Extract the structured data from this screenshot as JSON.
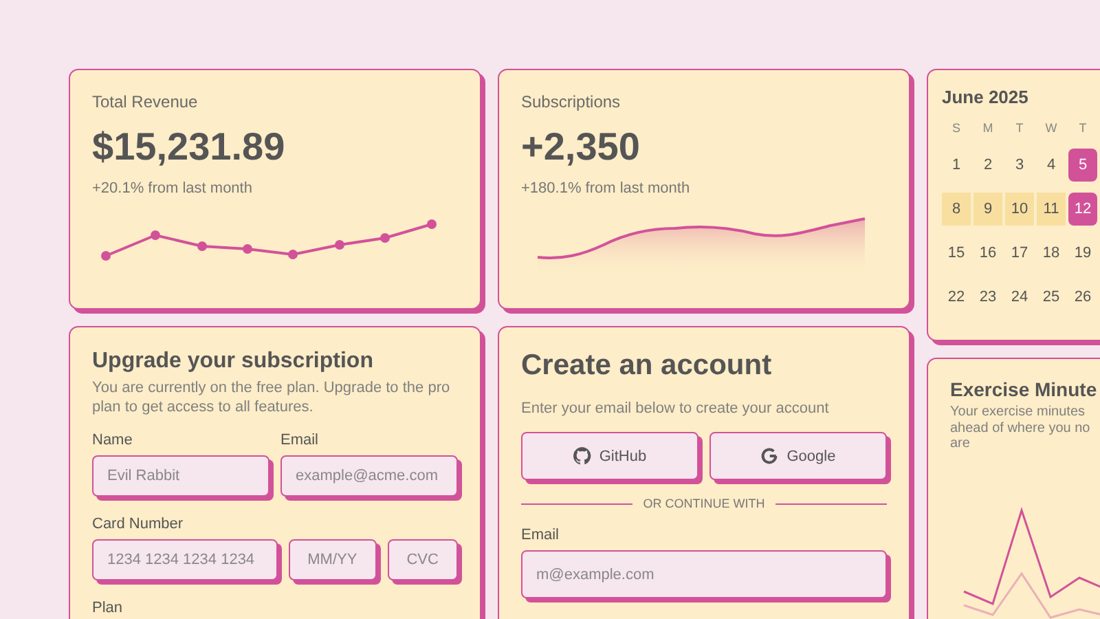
{
  "revenue": {
    "title": "Total Revenue",
    "value": "$15,231.89",
    "change": "+20.1% from last month"
  },
  "subscriptions": {
    "title": "Subscriptions",
    "value": "+2,350",
    "change": "+180.1% from last month"
  },
  "calendar": {
    "title": "June 2025",
    "weekdays": [
      "S",
      "M",
      "T",
      "W",
      "T"
    ],
    "weeks": [
      [
        {
          "label": "1",
          "selected": false,
          "in_range": false
        },
        {
          "label": "2",
          "selected": false,
          "in_range": false
        },
        {
          "label": "3",
          "selected": false,
          "in_range": false
        },
        {
          "label": "4",
          "selected": false,
          "in_range": false
        },
        {
          "label": "5",
          "selected": true,
          "in_range": false
        }
      ],
      [
        {
          "label": "8",
          "selected": false,
          "in_range": true
        },
        {
          "label": "9",
          "selected": false,
          "in_range": true
        },
        {
          "label": "10",
          "selected": false,
          "in_range": true
        },
        {
          "label": "11",
          "selected": false,
          "in_range": true
        },
        {
          "label": "12",
          "selected": true,
          "in_range": false
        }
      ],
      [
        {
          "label": "15",
          "selected": false,
          "in_range": false
        },
        {
          "label": "16",
          "selected": false,
          "in_range": false
        },
        {
          "label": "17",
          "selected": false,
          "in_range": false
        },
        {
          "label": "18",
          "selected": false,
          "in_range": false
        },
        {
          "label": "19",
          "selected": false,
          "in_range": false
        }
      ],
      [
        {
          "label": "22",
          "selected": false,
          "in_range": false
        },
        {
          "label": "23",
          "selected": false,
          "in_range": false
        },
        {
          "label": "24",
          "selected": false,
          "in_range": false
        },
        {
          "label": "25",
          "selected": false,
          "in_range": false
        },
        {
          "label": "26",
          "selected": false,
          "in_range": false
        }
      ]
    ]
  },
  "upgrade": {
    "title": "Upgrade your subscription",
    "description": "You are currently on the free plan. Upgrade to the pro plan to get access to all features.",
    "name_label": "Name",
    "name_field": {
      "placeholder": "Evil Rabbit"
    },
    "email_label": "Email",
    "email_field": {
      "placeholder": "example@acme.com"
    },
    "card_label": "Card Number",
    "card_field": {
      "placeholder": "1234 1234 1234 1234"
    },
    "expiry_field": {
      "placeholder": "MM/YY"
    },
    "cvc_field": {
      "placeholder": "CVC"
    },
    "plan_label": "Plan"
  },
  "create_account": {
    "title": "Create an account",
    "description": "Enter your email below to create your account",
    "buttons": [
      {
        "kind": "github",
        "label": "GitHub"
      },
      {
        "kind": "google",
        "label": "Google"
      }
    ],
    "divider": "OR CONTINUE WITH",
    "email_label": "Email",
    "email_field": {
      "placeholder": "m@example.com"
    }
  },
  "exercise": {
    "title": "Exercise Minute",
    "description_lines": [
      "Your exercise minutes",
      "ahead of where you no",
      "are"
    ]
  }
}
